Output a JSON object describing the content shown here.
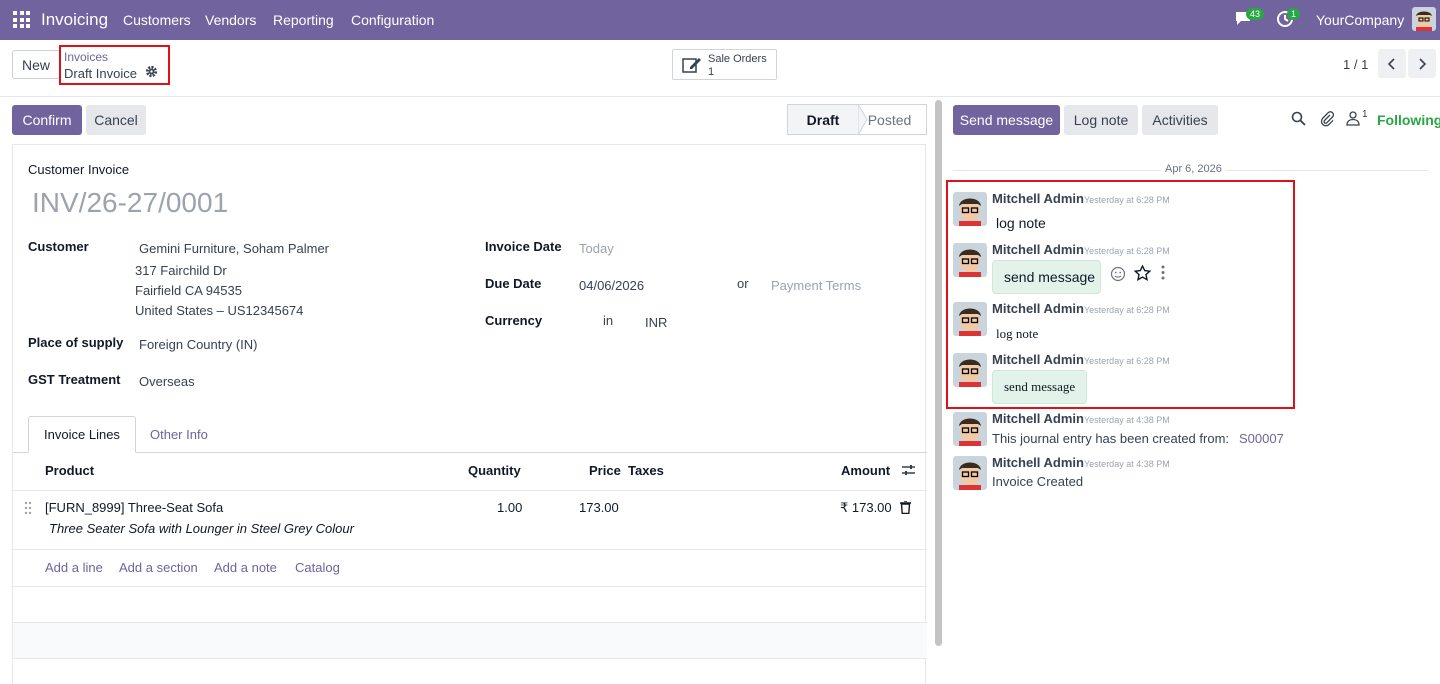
{
  "topbar": {
    "app_name": "Invoicing",
    "menu": [
      "Customers",
      "Vendors",
      "Reporting",
      "Configuration"
    ],
    "messages_badge": "43",
    "activities_badge": "1",
    "company": "YourCompany"
  },
  "control_panel": {
    "new_label": "New",
    "breadcrumb_parent": "Invoices",
    "breadcrumb_current": "Draft Invoice",
    "smart_button_label": "Sale Orders",
    "smart_button_count": "1",
    "pager": "1 / 1"
  },
  "actions": {
    "confirm": "Confirm",
    "cancel": "Cancel"
  },
  "status": {
    "draft": "Draft",
    "posted": "Posted"
  },
  "form": {
    "type_label": "Customer Invoice",
    "number": "INV/26-27/0001",
    "customer_label": "Customer",
    "customer_name": "Gemini Furniture, Soham Palmer",
    "address_line1": "317 Fairchild Dr",
    "address_line2": "Fairfield CA 94535",
    "address_line3": "United States – US12345674",
    "place_label": "Place of supply",
    "place_value": "Foreign Country (IN)",
    "gst_label": "GST Treatment",
    "gst_value": "Overseas",
    "invoice_date_label": "Invoice Date",
    "invoice_date_placeholder": "Today",
    "due_date_label": "Due Date",
    "due_date_value": "04/06/2026",
    "or_text": "or",
    "payment_terms_placeholder": "Payment Terms",
    "currency_label": "Currency",
    "currency_in": "in",
    "currency_value": "INR"
  },
  "tabs": [
    "Invoice Lines",
    "Other Info"
  ],
  "lines": {
    "headers": {
      "product": "Product",
      "quantity": "Quantity",
      "price": "Price",
      "taxes": "Taxes",
      "amount": "Amount"
    },
    "rows": [
      {
        "product": "[FURN_8999] Three-Seat Sofa",
        "description": "Three Seater Sofa with Lounger in Steel Grey Colour",
        "quantity": "1.00",
        "price": "173.00",
        "amount": "₹ 173.00"
      }
    ],
    "add_links": [
      "Add a line",
      "Add a section",
      "Add a note",
      "Catalog"
    ]
  },
  "chatter": {
    "send_message": "Send message",
    "log_note": "Log note",
    "activities": "Activities",
    "follower_count": "1",
    "following": "Following",
    "date": "Apr 6, 2026",
    "messages": [
      {
        "author": "Mitchell Admin",
        "time": "Yesterday at 6:28 PM",
        "body": "log note"
      },
      {
        "author": "Mitchell Admin",
        "time": "Yesterday at 6:28 PM",
        "body": "send message"
      },
      {
        "author": "Mitchell Admin",
        "time": "Yesterday at 6:28 PM",
        "body": "log note"
      },
      {
        "author": "Mitchell Admin",
        "time": "Yesterday at 6:28 PM",
        "body": "send message"
      },
      {
        "author": "Mitchell Admin",
        "time": "Yesterday at 4:38 PM",
        "body": "This journal entry has been created from:",
        "link": "S00007"
      },
      {
        "author": "Mitchell Admin",
        "time": "Yesterday at 4:38 PM",
        "body": "Invoice Created"
      }
    ]
  }
}
